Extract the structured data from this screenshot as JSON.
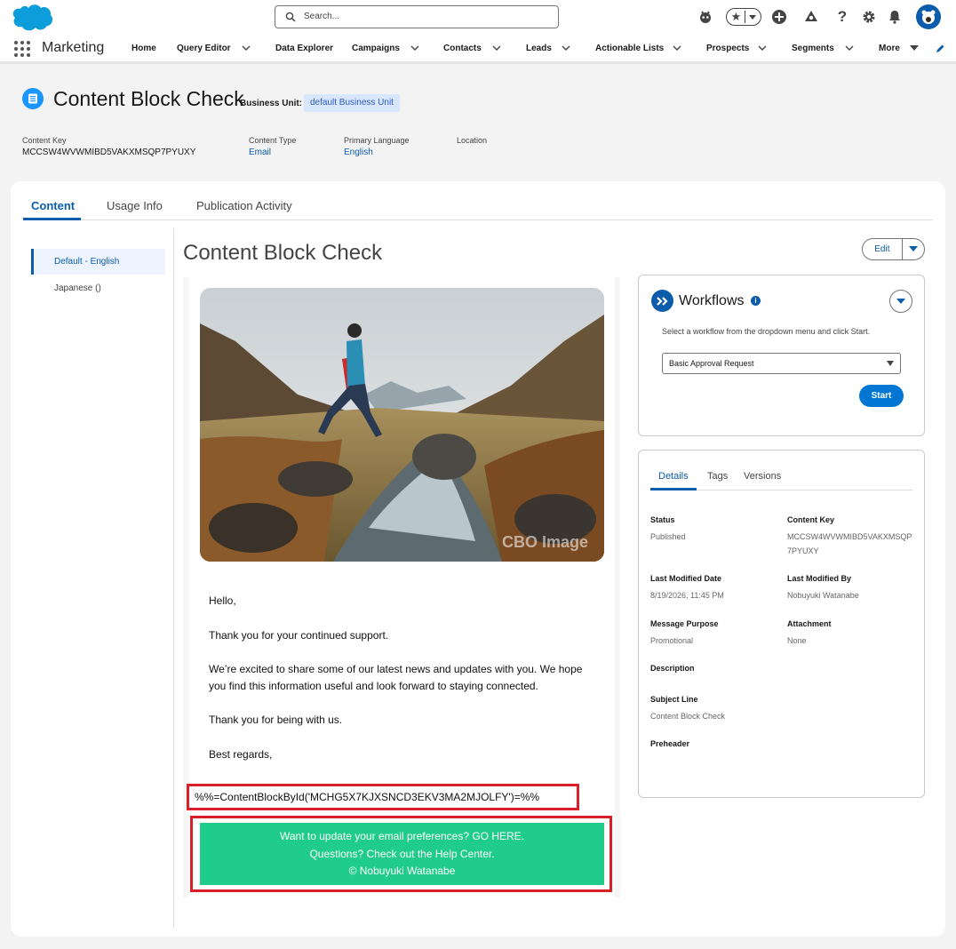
{
  "global_header": {
    "search_placeholder": "Search..."
  },
  "nav": {
    "app_name": "Marketing",
    "items": [
      {
        "label": "Home"
      },
      {
        "label": "Query Editor"
      },
      {
        "label": "Data Explorer"
      },
      {
        "label": "Campaigns"
      },
      {
        "label": "Contacts"
      },
      {
        "label": "Leads"
      },
      {
        "label": "Actionable Lists"
      },
      {
        "label": "Prospects"
      },
      {
        "label": "Segments"
      },
      {
        "label": "More"
      }
    ]
  },
  "record": {
    "title": "Content Block Check",
    "business_unit_label": "Business Unit:",
    "business_unit_value": "default Business Unit",
    "fields": [
      {
        "label": "Content Key",
        "value": "MCCSW4WVWMIBD5VAKXMSQP7PYUXY"
      },
      {
        "label": "Content Type",
        "value": "Email"
      },
      {
        "label": "Primary Language",
        "value": "English"
      },
      {
        "label": "Location",
        "value": ""
      }
    ]
  },
  "tabs": [
    {
      "label": "Content"
    },
    {
      "label": "Usage Info"
    },
    {
      "label": "Publication Activity"
    }
  ],
  "languages": [
    {
      "label": "Default - English"
    },
    {
      "label": "Japanese ()"
    }
  ],
  "content": {
    "title": "Content Block Check",
    "edit_label": "Edit"
  },
  "email": {
    "greeting": "Hello,",
    "p1": "Thank you for your continued support.",
    "p2": "We’re excited to share some of our latest news and updates with you. We hope you find this information useful and look forward to staying connected.",
    "p3": "Thank you for being with us.",
    "closing": "Best regards,",
    "ampscript": "%%=ContentBlockById('MCHG5X7KJXSNCD3EKV3MA2MJOLFY')=%%",
    "footer_line1": "Want to update your email preferences? GO HERE.",
    "footer_line2": "Questions? Check out the Help Center.",
    "footer_line3": "© Nobuyuki Watanabe",
    "hero_watermark": "CBO Image"
  },
  "workflows": {
    "title": "Workflows",
    "help_text": "Select a workflow from the dropdown menu and click Start.",
    "selected": "Basic Approval Request",
    "start_label": "Start"
  },
  "details": {
    "tabs": [
      {
        "label": "Details"
      },
      {
        "label": "Tags"
      },
      {
        "label": "Versions"
      }
    ],
    "status_label": "Status",
    "status_value": "Published",
    "content_key_label": "Content Key",
    "content_key_value": "MCCSW4WVWMIBD5VAKXMSQP7PYUXY",
    "last_modified_date_label": "Last Modified Date",
    "last_modified_date_value": "8/19/2026, 11:45 PM",
    "last_modified_by_label": "Last Modified By",
    "last_modified_by_value": "Nobuyuki Watanabe",
    "message_purpose_label": "Message Purpose",
    "message_purpose_value": "Promotional",
    "attachment_label": "Attachment",
    "attachment_value": "None",
    "description_label": "Description",
    "subject_line_label": "Subject Line",
    "subject_line_value": "Content Block Check",
    "preheader_label": "Preheader"
  },
  "colors": {
    "brand_blue": "#0b5cab",
    "accent_blue": "#0176d3",
    "footer_green": "#20cc8b",
    "highlight_red": "#d81f2a"
  }
}
